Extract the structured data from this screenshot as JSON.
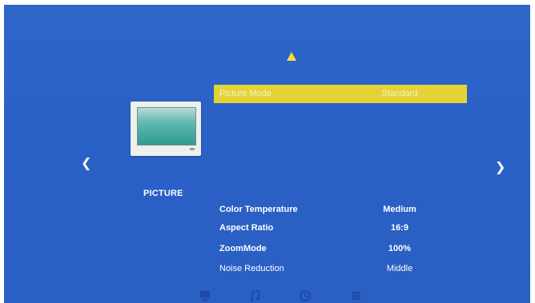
{
  "menu": {
    "section_title": "PICTURE",
    "items": [
      {
        "label": "Picture Mode",
        "value": "Standard"
      },
      {
        "label": "",
        "value": ""
      },
      {
        "label": "",
        "value": ""
      },
      {
        "label": "",
        "value": ""
      },
      {
        "label": "",
        "value": ""
      },
      {
        "label": "",
        "value": ""
      },
      {
        "label": "Color Temperature",
        "value": "Medium"
      },
      {
        "label": "Aspect Ratio",
        "value": "16:9"
      },
      {
        "label": "ZoomMode",
        "value": "100%"
      },
      {
        "label": "Noise Reduction",
        "value": "Middle"
      }
    ]
  },
  "icons": {
    "up": "triangle-up-icon",
    "left": "chevron-left-icon",
    "right": "chevron-right-icon",
    "tv": "tv-icon",
    "tabs": [
      "picture-tab-icon",
      "music-tab-icon",
      "clock-tab-icon",
      "settings-tab-icon"
    ]
  },
  "colors": {
    "background": "#2f66ca",
    "highlight": "#e4d335",
    "arrow": "#f1e038"
  }
}
